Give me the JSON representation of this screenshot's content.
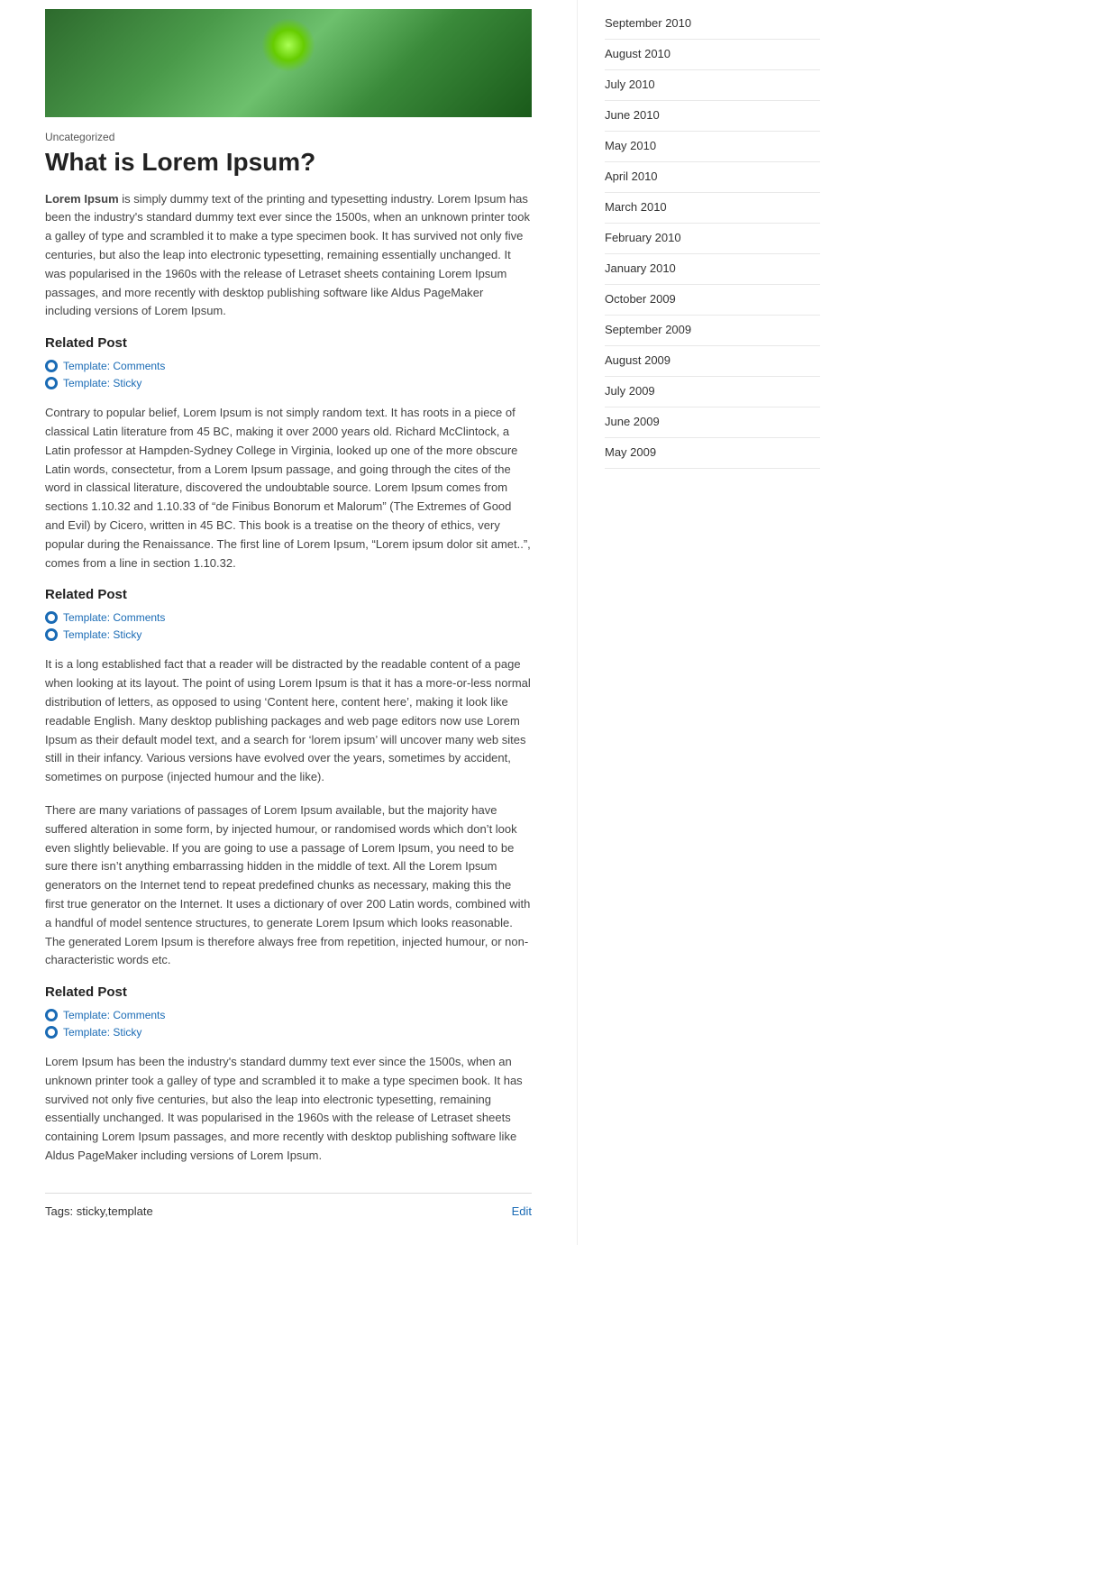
{
  "hero": {
    "alt": "Green nature background image"
  },
  "article": {
    "category": "Uncategorized",
    "title": "What is Lorem Ipsum?",
    "body_paragraph_1_bold": "Lorem Ipsum",
    "body_paragraph_1": " is simply dummy text of the printing and typesetting industry. Lorem Ipsum has been the industry's standard dummy text ever since the 1500s, when an unknown printer took a galley of type and scrambled it to make a type specimen book. It has survived not only five centuries, but also the leap into electronic typesetting, remaining essentially unchanged. It was popularised in the 1960s with the release of Letraset sheets containing Lorem Ipsum passages, and more recently with desktop publishing software like Aldus PageMaker including versions of Lorem Ipsum.",
    "related_post_1_heading": "Related Post",
    "related_post_1_links": [
      {
        "label": "Template: Comments",
        "href": "#"
      },
      {
        "label": "Template: Sticky",
        "href": "#"
      }
    ],
    "body_paragraph_2": "Contrary to popular belief, Lorem Ipsum is not simply random text. It has roots in a piece of classical Latin literature from 45 BC, making it over 2000 years old. Richard McClintock, a Latin professor at Hampden-Sydney College in Virginia, looked up one of the more obscure Latin words, consectetur, from a Lorem Ipsum passage, and going through the cites of the word in classical literature, discovered the undoubtable source. Lorem Ipsum comes from sections 1.10.32 and 1.10.33 of “de Finibus Bonorum et Malorum” (The Extremes of Good and Evil) by Cicero, written in 45 BC. This book is a treatise on the theory of ethics, very popular during the Renaissance. The first line of Lorem Ipsum, “Lorem ipsum dolor sit amet..”, comes from a line in section 1.10.32.",
    "related_post_2_heading": "Related Post",
    "related_post_2_links": [
      {
        "label": "Template: Comments",
        "href": "#"
      },
      {
        "label": "Template: Sticky",
        "href": "#"
      }
    ],
    "body_paragraph_3": "It is a long established fact that a reader will be distracted by the readable content of a page when looking at its layout. The point of using Lorem Ipsum is that it has a more-or-less normal distribution of letters, as opposed to using ‘Content here, content here’, making it look like readable English. Many desktop publishing packages and web page editors now use Lorem Ipsum as their default model text, and a search for ‘lorem ipsum’ will uncover many web sites still in their infancy. Various versions have evolved over the years, sometimes by accident, sometimes on purpose (injected humour and the like).",
    "body_paragraph_4": "There are many variations of passages of Lorem Ipsum available, but the majority have suffered alteration in some form, by injected humour, or randomised words which don’t look even slightly believable. If you are going to use a passage of Lorem Ipsum, you need to be sure there isn’t anything embarrassing hidden in the middle of text. All the Lorem Ipsum generators on the Internet tend to repeat predefined chunks as necessary, making this the first true generator on the Internet. It uses a dictionary of over 200 Latin words, combined with a handful of model sentence structures, to generate Lorem Ipsum which looks reasonable. The generated Lorem Ipsum is therefore always free from repetition, injected humour, or non-characteristic words etc.",
    "related_post_3_heading": "Related Post",
    "related_post_3_links": [
      {
        "label": "Template: Comments",
        "href": "#"
      },
      {
        "label": "Template: Sticky",
        "href": "#"
      }
    ],
    "body_paragraph_5": "Lorem Ipsum has been the industry's standard dummy text ever since the 1500s, when an unknown printer took a galley of type and scrambled it to make a type specimen book. It has survived not only five centuries, but also the leap into electronic typesetting, remaining essentially unchanged. It was popularised in the 1960s with the release of Letraset sheets containing Lorem Ipsum passages, and more recently with desktop publishing software like Aldus PageMaker including versions of Lorem Ipsum.",
    "footer_tags_label": "Tags:",
    "footer_tags_value": "sticky,template",
    "footer_edit_label": "Edit"
  },
  "sidebar": {
    "archive_items": [
      {
        "label": "September 2010",
        "href": "#"
      },
      {
        "label": "August 2010",
        "href": "#"
      },
      {
        "label": "July 2010",
        "href": "#"
      },
      {
        "label": "June 2010",
        "href": "#"
      },
      {
        "label": "May 2010",
        "href": "#"
      },
      {
        "label": "April 2010",
        "href": "#"
      },
      {
        "label": "March 2010",
        "href": "#"
      },
      {
        "label": "February 2010",
        "href": "#"
      },
      {
        "label": "January 2010",
        "href": "#"
      },
      {
        "label": "October 2009",
        "href": "#"
      },
      {
        "label": "September 2009",
        "href": "#"
      },
      {
        "label": "August 2009",
        "href": "#"
      },
      {
        "label": "July 2009",
        "href": "#"
      },
      {
        "label": "June 2009",
        "href": "#"
      },
      {
        "label": "May 2009",
        "href": "#"
      }
    ]
  }
}
